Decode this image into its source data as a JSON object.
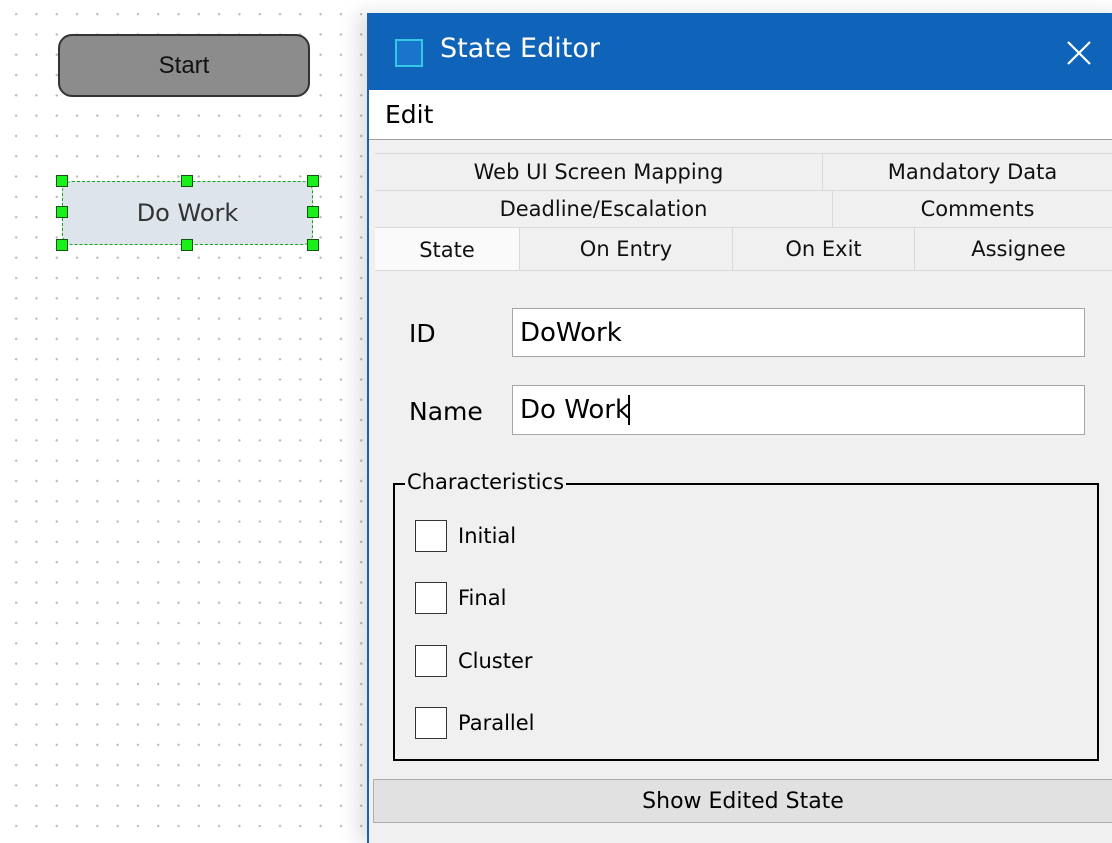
{
  "canvas": {
    "start_node": {
      "label": "Start"
    },
    "work_node": {
      "label": "Do Work"
    }
  },
  "dialog": {
    "title": "State Editor",
    "close_icon": "close-icon",
    "app_icon": "window-icon",
    "menu": {
      "edit": "Edit"
    },
    "tabs": {
      "row1": [
        "Web UI Screen Mapping",
        "Mandatory Data"
      ],
      "row2": [
        "Deadline/Escalation",
        "Comments"
      ],
      "row3": [
        "State",
        "On Entry",
        "On Exit",
        "Assignee"
      ],
      "active": "State"
    },
    "form": {
      "id_label": "ID",
      "id_value": "DoWork",
      "name_label": "Name",
      "name_value": "Do Work"
    },
    "characteristics": {
      "title": "Characteristics",
      "options": [
        {
          "label": "Initial",
          "checked": false
        },
        {
          "label": "Final",
          "checked": false
        },
        {
          "label": "Cluster",
          "checked": false
        },
        {
          "label": "Parallel",
          "checked": false
        }
      ]
    },
    "show_button": "Show Edited State"
  },
  "colors": {
    "titlebar": "#0f63b8",
    "selection_handle": "#19f019",
    "start_fill": "#8c8c8c",
    "work_fill": "#dde4ec"
  }
}
